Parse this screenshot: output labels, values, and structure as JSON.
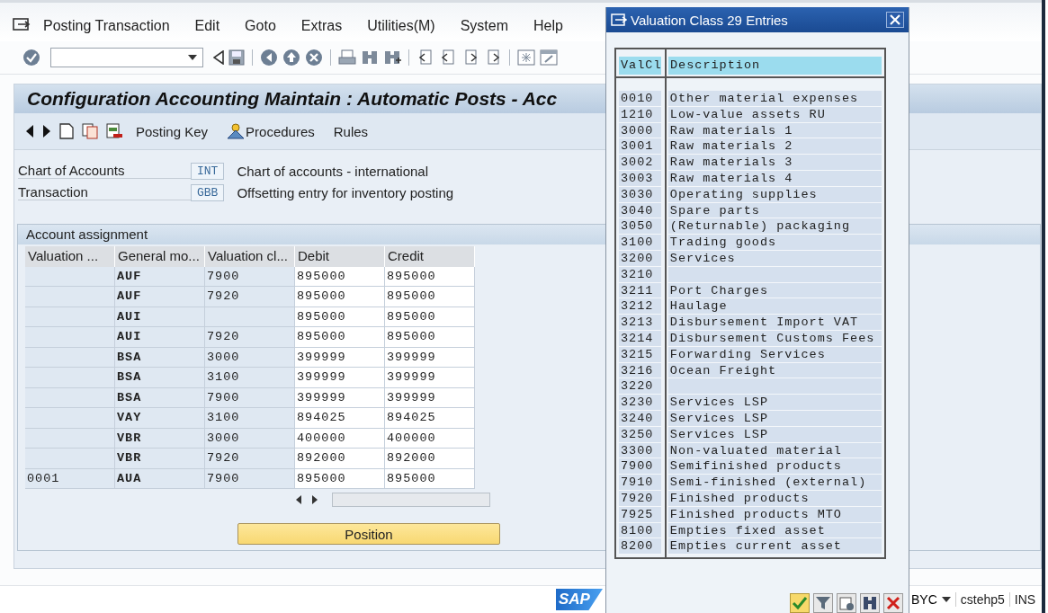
{
  "menu_bar": {
    "items": [
      "Posting Transaction",
      "Edit",
      "Goto",
      "Extras",
      "Utilities(M)",
      "System",
      "Help"
    ]
  },
  "title": "Configuration Accounting Maintain : Automatic Posts - Acc",
  "app_toolbar": {
    "buttons": [
      {
        "label": "Posting Key",
        "kind": "plain"
      },
      {
        "label": "Procedures",
        "kind": "person"
      },
      {
        "label": "Rules",
        "kind": "plain"
      }
    ]
  },
  "header_fields": [
    {
      "label": "Chart of Accounts",
      "value": "INT",
      "description": "Chart of accounts - international"
    },
    {
      "label": "Transaction",
      "value": "GBB",
      "description": "Offsetting entry for inventory posting"
    }
  ],
  "account_assignment": {
    "title": "Account assignment",
    "columns": [
      "Valuation ...",
      "General mo...",
      "Valuation cl...",
      "Debit",
      "Credit"
    ],
    "rows": [
      {
        "general_modif": "AUF",
        "valuation_class": "7900",
        "debit": "895000",
        "credit": "895000"
      },
      {
        "general_modif": "AUF",
        "valuation_class": "7920",
        "debit": "895000",
        "credit": "895000"
      },
      {
        "general_modif": "AUI",
        "debit": "895000",
        "credit": "895000"
      },
      {
        "general_modif": "AUI",
        "valuation_class": "7920",
        "debit": "895000",
        "credit": "895000"
      },
      {
        "general_modif": "BSA",
        "valuation_class": "3000",
        "debit": "399999",
        "credit": "399999"
      },
      {
        "general_modif": "BSA",
        "valuation_class": "3100",
        "debit": "399999",
        "credit": "399999"
      },
      {
        "general_modif": "BSA",
        "valuation_class": "7900",
        "debit": "399999",
        "credit": "399999"
      },
      {
        "general_modif": "VAY",
        "valuation_class": "3100",
        "debit": "894025",
        "credit": "894025"
      },
      {
        "general_modif": "VBR",
        "valuation_class": "3000",
        "debit": "400000",
        "credit": "400000"
      },
      {
        "general_modif": "VBR",
        "valuation_class": "7920",
        "debit": "892000",
        "credit": "892000"
      },
      {
        "valuation_modif": "0001",
        "general_modif": "AUA",
        "valuation_class": "7900",
        "debit": "895000",
        "credit": "895000"
      }
    ]
  },
  "position_button": "Position",
  "status_bar": {
    "logo": "SAP",
    "system": "BYC",
    "server": "cstehp5",
    "mode": "INS"
  },
  "popup": {
    "title": "Valuation Class 29 Entries",
    "columns": [
      "ValCl",
      "Description"
    ],
    "rows": [
      {
        "code": "0010",
        "description": "Other material expenses"
      },
      {
        "code": "1210",
        "description": "Low-value assets RU"
      },
      {
        "code": "3000",
        "description": "Raw materials 1"
      },
      {
        "code": "3001",
        "description": "Raw materials 2"
      },
      {
        "code": "3002",
        "description": "Raw materials 3"
      },
      {
        "code": "3003",
        "description": "Raw materials 4"
      },
      {
        "code": "3030",
        "description": "Operating supplies"
      },
      {
        "code": "3040",
        "description": "Spare parts"
      },
      {
        "code": "3050",
        "description": "(Returnable) packaging"
      },
      {
        "code": "3100",
        "description": "Trading goods"
      },
      {
        "code": "3200",
        "description": "Services"
      },
      {
        "code": "3210"
      },
      {
        "code": "3211",
        "description": "Port Charges"
      },
      {
        "code": "3212",
        "description": "Haulage"
      },
      {
        "code": "3213",
        "description": "Disbursement Import VAT"
      },
      {
        "code": "3214",
        "description": "Disbursement Customs Fees"
      },
      {
        "code": "3215",
        "description": "Forwarding Services"
      },
      {
        "code": "3216",
        "description": "Ocean Freight"
      },
      {
        "code": "3220"
      },
      {
        "code": "3230",
        "description": "Services LSP"
      },
      {
        "code": "3240",
        "description": "Services LSP"
      },
      {
        "code": "3250",
        "description": "Services LSP"
      },
      {
        "code": "3300",
        "description": "Non-valuated material"
      },
      {
        "code": "7900",
        "description": "Semifinished products"
      },
      {
        "code": "7910",
        "description": "Semi-finished (external)"
      },
      {
        "code": "7920",
        "description": "Finished products"
      },
      {
        "code": "7925",
        "description": "Finished products MTO"
      },
      {
        "code": "8100",
        "description": "Empties fixed asset"
      },
      {
        "code": "8200",
        "description": "Empties current asset"
      }
    ]
  }
}
